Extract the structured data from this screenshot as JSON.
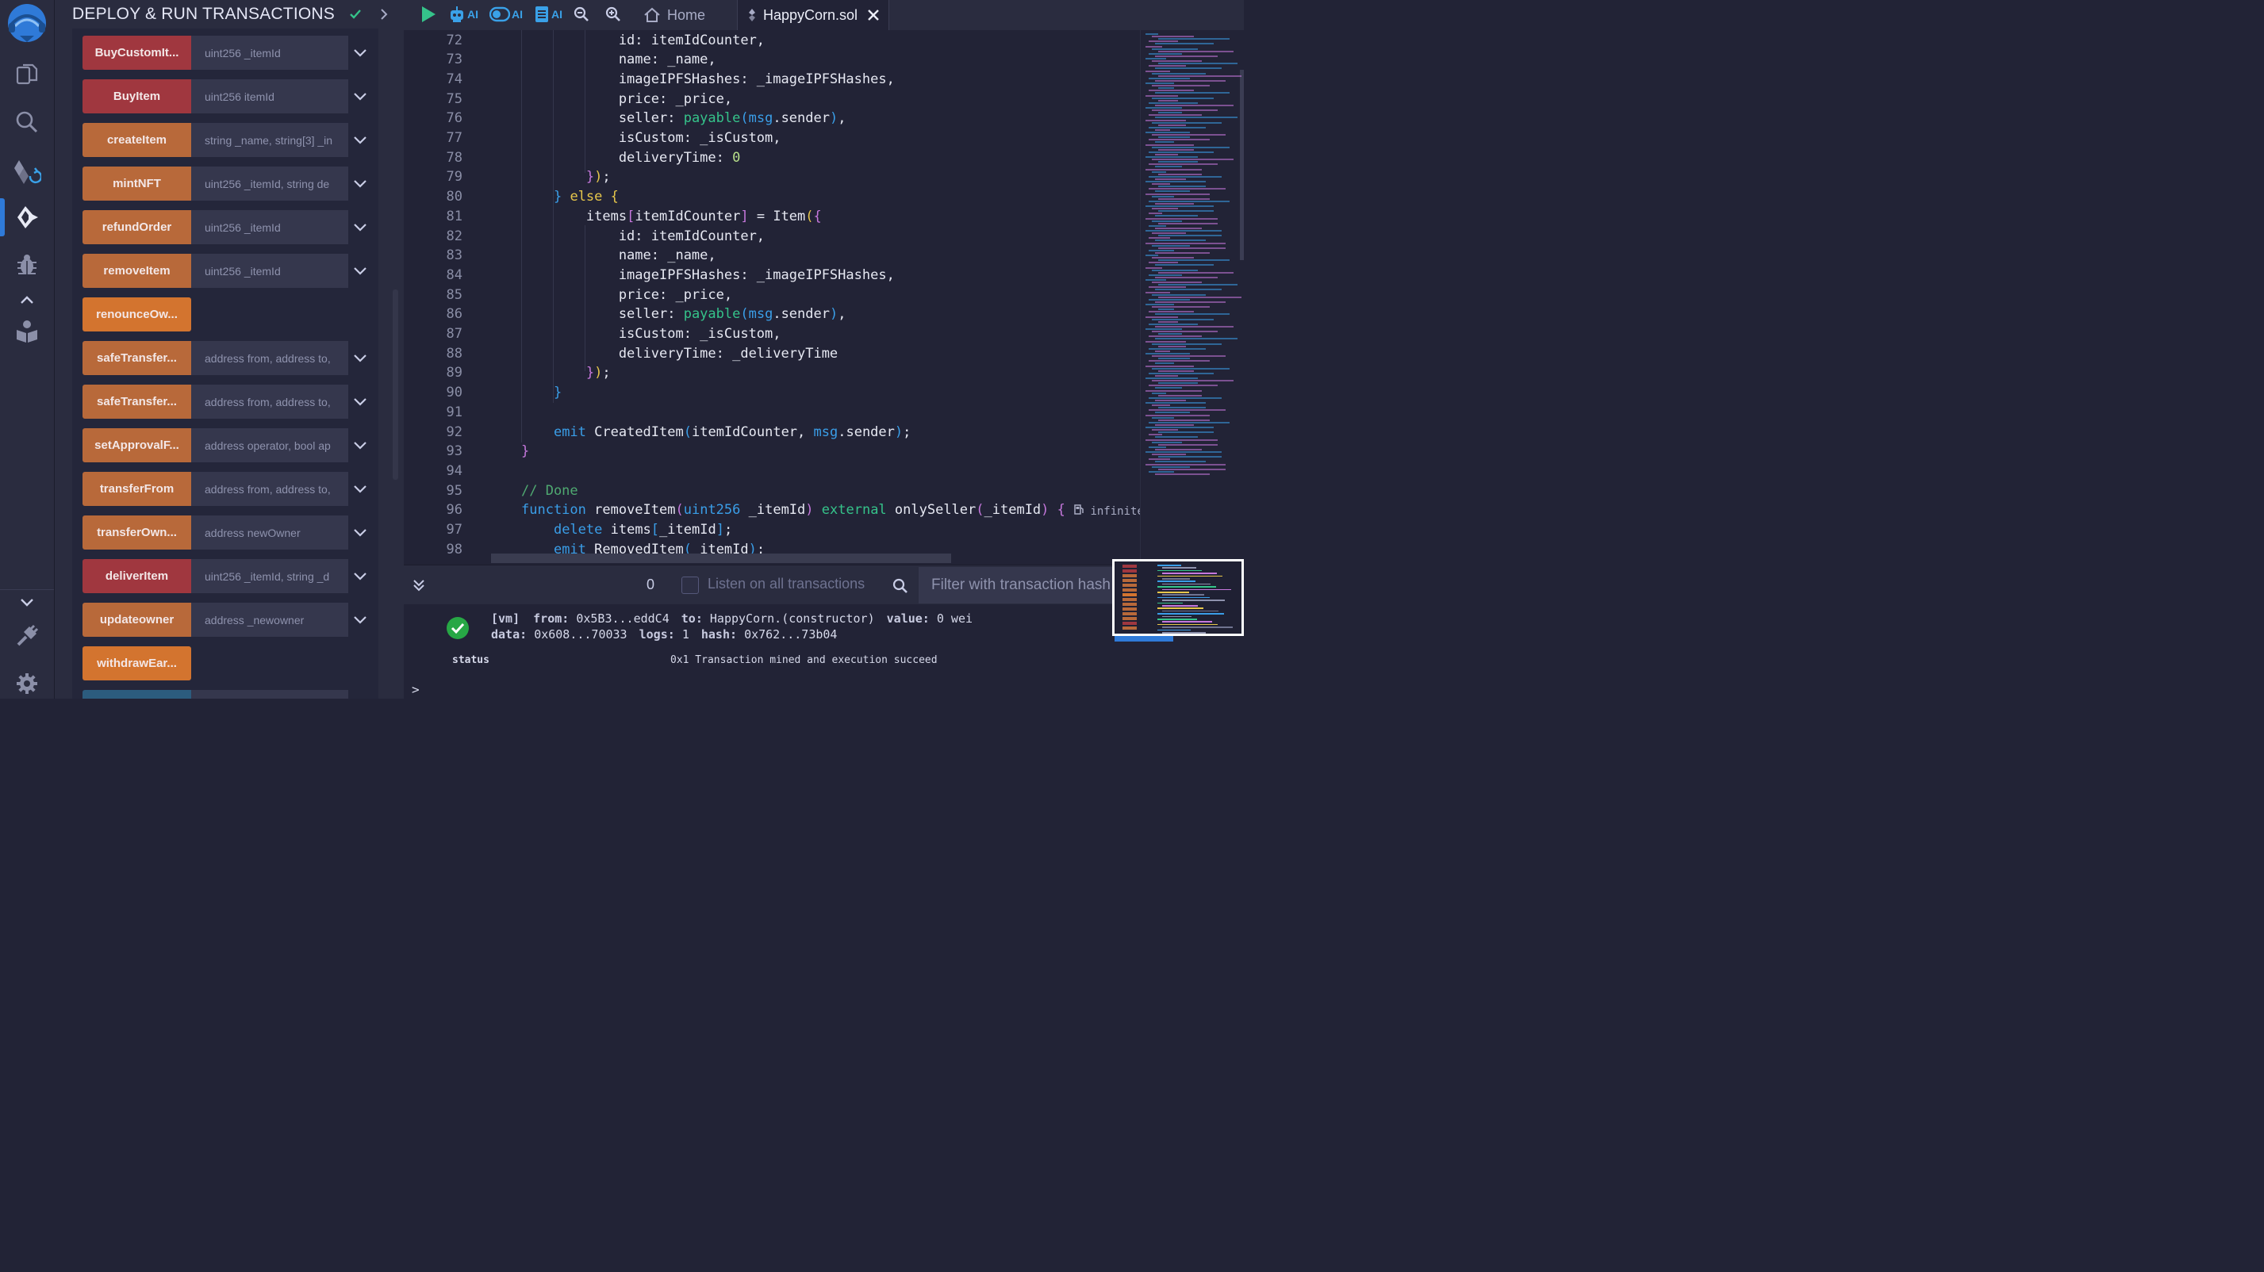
{
  "panel": {
    "title": "DEPLOY & RUN TRANSACTIONS"
  },
  "functions": [
    {
      "label": "BuyCustomIt...",
      "param": "uint256 _itemId",
      "color": "#a0373f",
      "has_input": true
    },
    {
      "label": "BuyItem",
      "param": "uint256 itemId",
      "color": "#a0373f",
      "has_input": true
    },
    {
      "label": "createItem",
      "param": "string _name, string[3] _in",
      "color": "#b8693a",
      "has_input": true
    },
    {
      "label": "mintNFT",
      "param": "uint256 _itemId, string de",
      "color": "#b8693a",
      "has_input": true
    },
    {
      "label": "refundOrder",
      "param": "uint256 _itemId",
      "color": "#b8693a",
      "has_input": true
    },
    {
      "label": "removeItem",
      "param": "uint256 _itemId",
      "color": "#b8693a",
      "has_input": true
    },
    {
      "label": "renounceOw...",
      "param": "",
      "color": "#d3742f",
      "has_input": false
    },
    {
      "label": "safeTransfer...",
      "param": "address from, address to,",
      "color": "#b8693a",
      "has_input": true
    },
    {
      "label": "safeTransfer...",
      "param": "address from, address to,",
      "color": "#b8693a",
      "has_input": true
    },
    {
      "label": "setApprovalF...",
      "param": "address operator, bool ap",
      "color": "#b8693a",
      "has_input": true
    },
    {
      "label": "transferFrom",
      "param": "address from, address to,",
      "color": "#b8693a",
      "has_input": true
    },
    {
      "label": "transferOwn...",
      "param": "address newOwner",
      "color": "#b8693a",
      "has_input": true
    },
    {
      "label": "deliverItem",
      "param": "uint256 _itemId, string _d",
      "color": "#a0373f",
      "has_input": true
    },
    {
      "label": "updateowner",
      "param": "address _newowner",
      "color": "#b8693a",
      "has_input": true
    },
    {
      "label": "withdrawEar...",
      "param": "",
      "color": "#d3742f",
      "has_input": false
    }
  ],
  "toolbar": {
    "ai_label": "AI",
    "home_tab": "Home",
    "file_tab": "HappyCorn.sol"
  },
  "editor": {
    "gas_label": "infinite",
    "lines": [
      {
        "n": "72",
        "html": "            id: itemIdCounter,"
      },
      {
        "n": "73",
        "html": "            name: _name,"
      },
      {
        "n": "74",
        "html": "            imageIPFSHashes: _imageIPFSHashes,"
      },
      {
        "n": "75",
        "html": "            price: _price,"
      },
      {
        "n": "76",
        "html": "            seller: <span class=\"grn\">payable</span><span class=\"kw\">(</span><span class=\"kw\">msg</span>.sender<span class=\"kw\">)</span>,"
      },
      {
        "n": "77",
        "html": "            isCustom: _isCustom,"
      },
      {
        "n": "78",
        "html": "            deliveryTime: <span class=\"num\">0</span>"
      },
      {
        "n": "79",
        "html": "        <span class=\"pur\">}</span><span class=\"yel\">)</span>;"
      },
      {
        "n": "80",
        "html": "    <span class=\"kw\">}</span> <span class=\"yel\">else</span> <span class=\"yel\">{</span>"
      },
      {
        "n": "81",
        "html": "        items<span class=\"pur\">[</span>itemIdCounter<span class=\"pur\">]</span> = Item<span class=\"yel\">(</span><span class=\"pur\">{</span>"
      },
      {
        "n": "82",
        "html": "            id: itemIdCounter,"
      },
      {
        "n": "83",
        "html": "            name: _name,"
      },
      {
        "n": "84",
        "html": "            imageIPFSHashes: _imageIPFSHashes,"
      },
      {
        "n": "85",
        "html": "            price: _price,"
      },
      {
        "n": "86",
        "html": "            seller: <span class=\"grn\">payable</span><span class=\"kw\">(</span><span class=\"kw\">msg</span>.sender<span class=\"kw\">)</span>,"
      },
      {
        "n": "87",
        "html": "            isCustom: _isCustom,"
      },
      {
        "n": "88",
        "html": "            deliveryTime: _deliveryTime"
      },
      {
        "n": "89",
        "html": "        <span class=\"pur\">}</span><span class=\"yel\">)</span>;"
      },
      {
        "n": "90",
        "html": "    <span class=\"kw\">}</span>"
      },
      {
        "n": "91",
        "html": ""
      },
      {
        "n": "92",
        "html": "    <span class=\"kw\">emit</span> CreatedItem<span class=\"kw\">(</span>itemIdCounter, <span class=\"kw\">msg</span>.sender<span class=\"kw\">)</span>;"
      },
      {
        "n": "93",
        "html": "<span class=\"pur\">}</span>"
      },
      {
        "n": "94",
        "html": ""
      },
      {
        "n": "95",
        "html": "<span class=\"cmt\">// Done</span>"
      },
      {
        "n": "96",
        "html": "<span class=\"kw\">function</span> removeItem<span class=\"pur\">(</span><span class=\"typ\">uint256</span> _itemId<span class=\"pur\">)</span> <span class=\"grn\">external</span> onlySeller<span class=\"pur\">(</span>_itemId<span class=\"pur\">)</span> <span class=\"pur\">{</span>"
      },
      {
        "n": "97",
        "html": "    <span class=\"kw\">delete</span> items<span class=\"kw\">[</span>_itemId<span class=\"kw\">]</span>;"
      },
      {
        "n": "98",
        "html": "    <span class=\"kw\">emit</span> RemovedItem<span class=\"kw\">(</span>_itemId<span class=\"kw\">)</span>;"
      }
    ]
  },
  "terminal": {
    "tx_count": "0",
    "listen_label": "Listen on all transactions",
    "filter_placeholder": "Filter with transaction hash",
    "line1_tag": "[vm]",
    "from_label": "from:",
    "from_value": "0x5B3...eddC4",
    "to_label": "to:",
    "to_value": "HappyCorn.(constructor)",
    "value_label": "value:",
    "value_value": "0 wei",
    "data_label": "data:",
    "data_value": "0x608...70033",
    "logs_label": "logs:",
    "logs_value": "1",
    "hash_label": "hash:",
    "hash_value": "0x762...73b04",
    "status_label": "status",
    "status_value": "0x1 Transaction mined and execution succeed",
    "prompt": ">"
  },
  "colors": {
    "accent": "#2f7ad8",
    "success": "#27a745"
  }
}
